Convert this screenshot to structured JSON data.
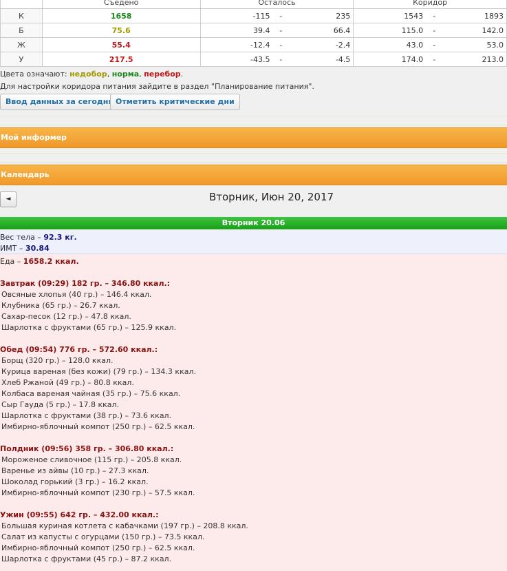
{
  "table": {
    "headers": [
      "Съедено",
      "Осталось",
      "Коридор"
    ],
    "rows": [
      {
        "label": "К",
        "eaten": "1658",
        "eaten_color": "#1e8a1e",
        "left_from": "-115",
        "left_to": "235",
        "corr_from": "1543",
        "corr_to": "1893"
      },
      {
        "label": "Б",
        "eaten": "75.6",
        "eaten_color": "#a39900",
        "left_from": "39.4",
        "left_to": "66.4",
        "corr_from": "115.0",
        "corr_to": "142.0"
      },
      {
        "label": "Ж",
        "eaten": "55.4",
        "eaten_color": "#c21818",
        "left_from": "-12.4",
        "left_to": "-2.4",
        "corr_from": "43.0",
        "corr_to": "53.0"
      },
      {
        "label": "У",
        "eaten": "217.5",
        "eaten_color": "#c21818",
        "left_from": "-43.5",
        "left_to": "-4.5",
        "corr_from": "174.0",
        "corr_to": "213.0"
      }
    ],
    "dash": "-"
  },
  "legend": {
    "prefix": "Цвета означают: ",
    "under": "недобор",
    "norm": "норма",
    "over": "перебор",
    "sep": ", ",
    "end": "."
  },
  "note": "Для настройки коридора питания зайдите в раздел \"Планирование питания\".",
  "buttons": {
    "enter_today": "Ввод данных за сегодня",
    "mark_days": "Отметить критические дни"
  },
  "panels": {
    "informer": "Мой информер",
    "calendar": "Календарь"
  },
  "calendar": {
    "prev": "◄",
    "title": "Вторник, Июн 20, 2017",
    "day_label": "Вторник  20.06"
  },
  "metrics": {
    "weight_label": "Вес тела – ",
    "weight_value": "92.3 кг.",
    "bmi_label": "ИМТ – ",
    "bmi_value": "30.84"
  },
  "food_total": {
    "label": "Еда – ",
    "value": "1658.2 ккал."
  },
  "meals": [
    {
      "title": "Завтрак (09:29) 182 гр. – 346.80 ккал.:",
      "items": [
        "Овсяные хлопья (40 гр.) – 146.4 ккал.",
        "Клубника (65 гр.) – 26.7 ккал.",
        "Сахар-песок (12 гр.) – 47.8 ккал.",
        "Шарлотка с фруктами (65 гр.) – 125.9 ккал."
      ]
    },
    {
      "title": "Обед (09:54) 776 гр. – 572.60 ккал.:",
      "items": [
        "Борщ (320 гр.) – 128.0 ккал.",
        "Курица вареная (без кожи) (79 гр.) – 134.3 ккал.",
        "Хлеб Ржаной (49 гр.) – 80.8 ккал.",
        "Колбаса вареная чайная (35 гр.) – 75.6 ккал.",
        "Сыр Гауда (5 гр.) – 17.8 ккал.",
        "Шарлотка с фруктами (38 гр.) – 73.6 ккал.",
        "Имбирно-яблочный компот (250 гр.) – 62.5 ккал."
      ]
    },
    {
      "title": "Полдник (09:56) 358 гр. – 306.80 ккал.:",
      "items": [
        "Мороженое сливочное (115 гр.) – 205.8 ккал.",
        "Варенье из айвы (10 гр.) – 27.3 ккал.",
        "Шоколад горький (3 гр.) – 16.2 ккал.",
        "Имбирно-яблочный компот (230 гр.) – 57.5 ккал."
      ]
    },
    {
      "title": "Ужин (09:55) 642 гр. – 432.00 ккал.:",
      "items": [
        "Большая куриная котлета с кабачками (197 гр.) – 208.8 ккал.",
        "Салат из капусты с огурцами (150 гр.) – 73.5 ккал.",
        "Имбирно-яблочный компот (250 гр.) – 62.5 ккал.",
        "Шарлотка с фруктами (45 гр.) – 87.2 ккал."
      ]
    }
  ]
}
